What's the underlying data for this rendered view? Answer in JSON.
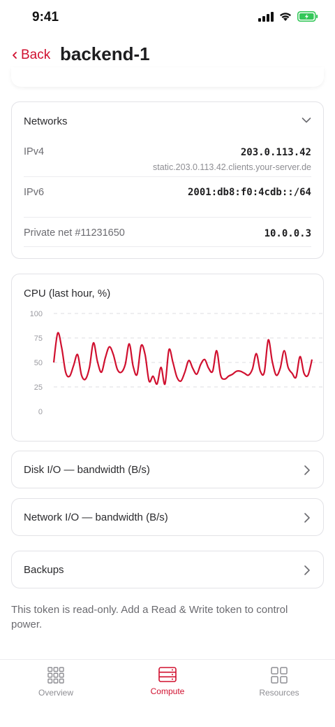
{
  "status_bar": {
    "time": "9:41",
    "icons": [
      "signal-icon",
      "wifi-icon",
      "battery-charging-icon"
    ]
  },
  "nav": {
    "back_label": "Back",
    "title": "backend-1"
  },
  "networks": {
    "title": "Networks",
    "rows": [
      {
        "label": "IPv4",
        "value": "203.0.113.42",
        "sub": "static.203.0.113.42.clients.your-server.de"
      },
      {
        "label": "IPv6",
        "value": "2001:db8:f0:4cdb::/64"
      },
      {
        "label": "Private net #11231650",
        "value": "10.0.0.3"
      }
    ]
  },
  "cpu": {
    "title": "CPU (last hour, %)"
  },
  "chart_data": {
    "type": "line",
    "title": "CPU (last hour, %)",
    "xlabel": "",
    "ylabel": "",
    "ylim": [
      0,
      100
    ],
    "yticks": [
      "100",
      "75",
      "50",
      "25",
      "0"
    ],
    "grid": true,
    "series_color": "#d0102f",
    "values": [
      50,
      80,
      65,
      40,
      36,
      47,
      58,
      37,
      33,
      45,
      70,
      51,
      40,
      55,
      66,
      58,
      43,
      40,
      48,
      69,
      46,
      38,
      67,
      58,
      31,
      36,
      28,
      45,
      28,
      63,
      50,
      35,
      31,
      40,
      52,
      44,
      38,
      48,
      53,
      44,
      41,
      62,
      37,
      33,
      36,
      38,
      41,
      41,
      39,
      37,
      43,
      59,
      41,
      40,
      73,
      51,
      37,
      44,
      62,
      45,
      39,
      35,
      56,
      39,
      37,
      53
    ]
  },
  "sections": [
    {
      "label": "Disk I/O — bandwidth (B/s)"
    },
    {
      "label": "Network I/O — bandwidth (B/s)"
    },
    {
      "label": "Backups"
    }
  ],
  "info_text": "This token is read-only. Add a Read & Write token to control power.",
  "tabs": [
    {
      "label": "Overview",
      "icon": "grid-nine-icon",
      "active": false
    },
    {
      "label": "Compute",
      "icon": "server-icon",
      "active": true
    },
    {
      "label": "Resources",
      "icon": "grid-four-icon",
      "active": false
    }
  ],
  "colors": {
    "accent": "#d0102f",
    "battery": "#34c759",
    "muted_text": "#6b6b70",
    "border": "#e2e2e6"
  }
}
